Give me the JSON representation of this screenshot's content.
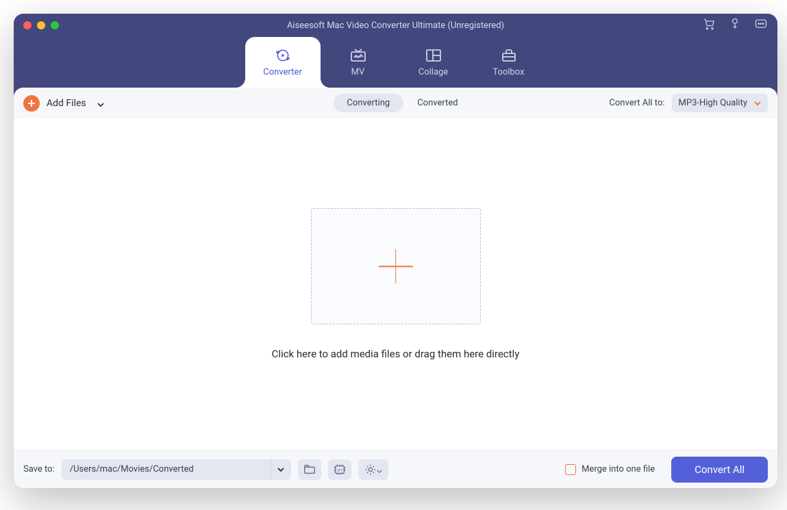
{
  "window": {
    "title": "Aiseesoft Mac Video Converter Ultimate (Unregistered)"
  },
  "titlebar_icons": {
    "cart": "cart-icon",
    "key": "key-icon",
    "feedback": "feedback-icon"
  },
  "tabs": [
    {
      "id": "converter",
      "label": "Converter",
      "active": true
    },
    {
      "id": "mv",
      "label": "MV",
      "active": false
    },
    {
      "id": "collage",
      "label": "Collage",
      "active": false
    },
    {
      "id": "toolbox",
      "label": "Toolbox",
      "active": false
    }
  ],
  "toolbar": {
    "add_files_label": "Add Files",
    "segment_converting": "Converting",
    "segment_converted": "Converted",
    "convert_all_to_label": "Convert All to:",
    "format_selected": "MP3-High Quality"
  },
  "dropzone": {
    "hint": "Click here to add media files or drag them here directly"
  },
  "footer": {
    "save_to_label": "Save to:",
    "save_path": "/Users/mac/Movies/Converted",
    "merge_label": "Merge into one file",
    "convert_button": "Convert All"
  }
}
